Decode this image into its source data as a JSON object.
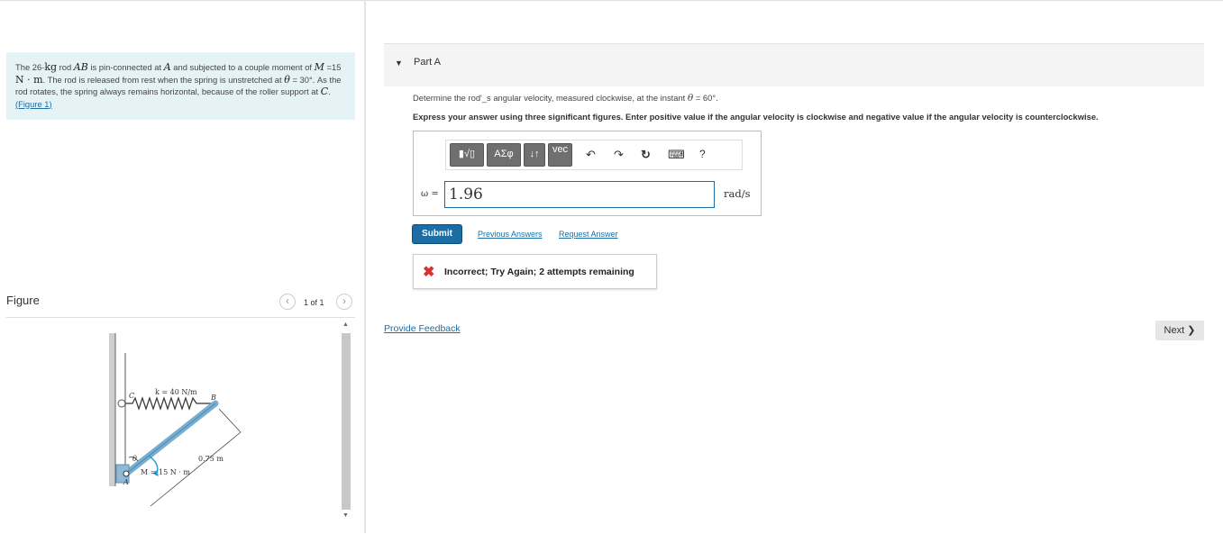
{
  "problem": {
    "text_pre1": "The 26-",
    "kg": "kg",
    "text_pre2": " rod ",
    "rod": "AB",
    "text_pre3": " is pin-connected at ",
    "pin": "A",
    "text_pre4": " and subjected to a couple moment of ",
    "moment_sym": "M",
    "moment_val": " =15 ",
    "moment_unit": "N · m",
    "text_pre5": ". The rod is released from rest when the spring is unstretched at ",
    "theta": "θ",
    "angle": " = 30°",
    "text_pre6": ". As the rod rotates, the spring always remains horizontal, because of the roller support at ",
    "support": "C",
    "text_pre7": ". ",
    "figure_link": "(Figure 1)"
  },
  "figure": {
    "label": "Figure",
    "pager": "1 of 1",
    "prev_icon": "‹",
    "next_icon": "›",
    "labels": {
      "c": "C",
      "k": "k = 40 N/m",
      "b": "B",
      "theta": "θ",
      "length": "0.75 m",
      "moment": "M = 15 N · m",
      "a": "A"
    }
  },
  "part": {
    "caret": "▼",
    "title": "Part A",
    "question_pre": "Determine the rod'_s angular velocity, measured clockwise, at the instant ",
    "question_theta": "θ",
    "question_post": " = 60°.",
    "instruction": "Express your answer using three significant figures. Enter positive value if the angular velocity is clockwise and negative value if the angular velocity is counterclockwise."
  },
  "toolbar": {
    "templates": "▮√▯",
    "greek": "ΑΣφ",
    "arrows": "↓↑",
    "vec": "vec",
    "undo": "↶",
    "redo": "↷",
    "reset": "↻",
    "keyboard": "⌨",
    "help": "?"
  },
  "answer": {
    "label": "ω =",
    "value": "1.96",
    "unit": "rad/s"
  },
  "actions": {
    "submit": "Submit",
    "previous": "Previous Answers",
    "request": "Request Answer"
  },
  "feedback": {
    "icon": "✖",
    "message": "Incorrect; Try Again; 2 attempts remaining"
  },
  "footer": {
    "provide_feedback": "Provide Feedback",
    "next": "Next ❯"
  },
  "colors": {
    "accent": "#1a6ea5",
    "error": "#d1342f",
    "problem_bg": "#e5f3f6"
  }
}
